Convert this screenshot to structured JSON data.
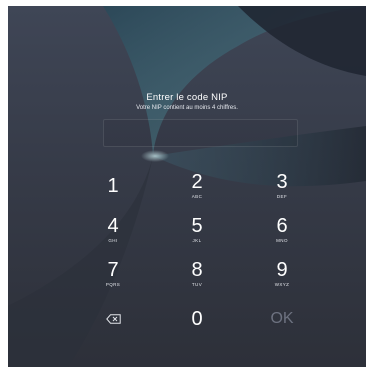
{
  "prompt": {
    "title": "Entrer le code NIP",
    "subtitle": "Votre NIP contient au moins 4 chiffres."
  },
  "keypad": {
    "k1": {
      "digit": "1",
      "letters": ""
    },
    "k2": {
      "digit": "2",
      "letters": "ABC"
    },
    "k3": {
      "digit": "3",
      "letters": "DEF"
    },
    "k4": {
      "digit": "4",
      "letters": "GHI"
    },
    "k5": {
      "digit": "5",
      "letters": "JKL"
    },
    "k6": {
      "digit": "6",
      "letters": "MNO"
    },
    "k7": {
      "digit": "7",
      "letters": "PQRS"
    },
    "k8": {
      "digit": "8",
      "letters": "TUV"
    },
    "k9": {
      "digit": "9",
      "letters": "WXYZ"
    },
    "k0": {
      "digit": "0"
    },
    "ok": {
      "label": "OK"
    },
    "backspace_icon": "backspace-icon"
  },
  "colors": {
    "background": "#363b48",
    "text": "#ffffff",
    "ok_disabled": "#6d7280",
    "wallpaper_accent": "#4f7a88"
  }
}
